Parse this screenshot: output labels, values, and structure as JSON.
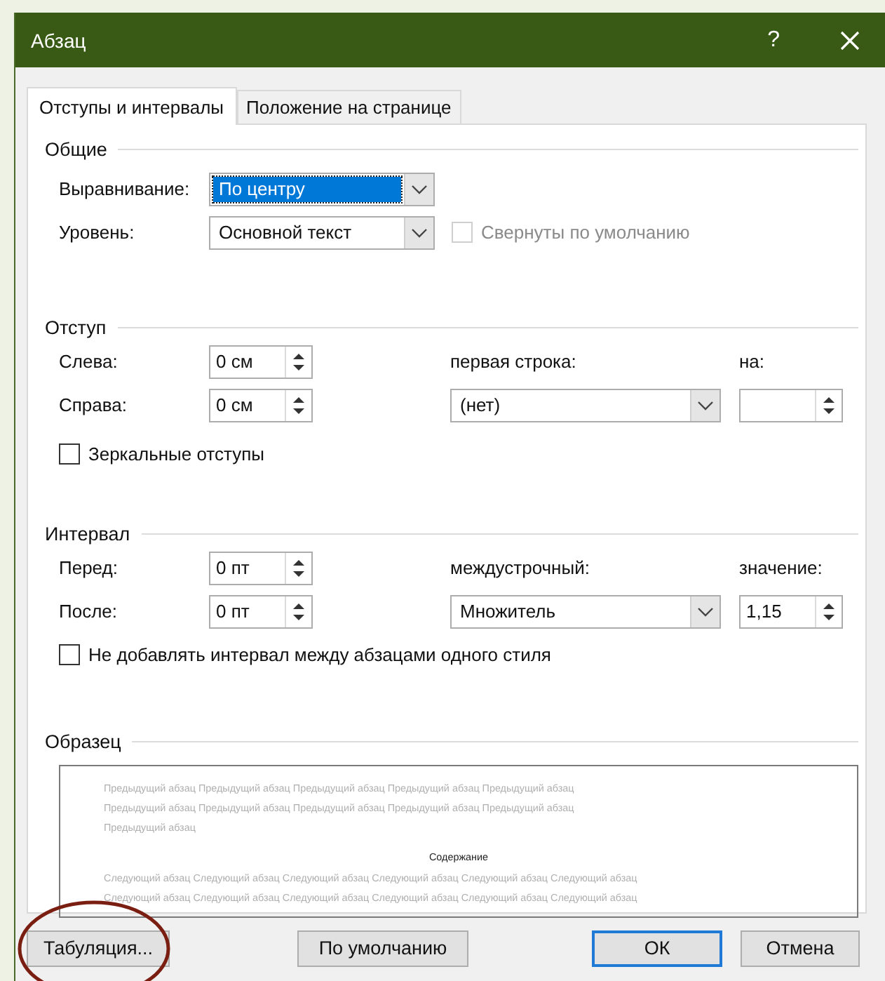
{
  "window": {
    "title": "Абзац",
    "help": "?"
  },
  "tabs": [
    {
      "label": "Отступы и интервалы",
      "selected": true
    },
    {
      "label": "Положение на странице",
      "selected": false
    }
  ],
  "general": {
    "title": "Общие",
    "alignment": {
      "label": "Выравнивание:",
      "value": "По центру",
      "focused": true
    },
    "level": {
      "label": "Уровень:",
      "value": "Основной текст"
    },
    "collapsed": {
      "label": "Свернуты по умолчанию",
      "checked": false,
      "disabled": true
    }
  },
  "indent": {
    "title": "Отступ",
    "left": {
      "label": "Слева:",
      "value": "0 см"
    },
    "right": {
      "label": "Справа:",
      "value": "0 см"
    },
    "first_line": {
      "label": "первая строка:",
      "value": "(нет)"
    },
    "by": {
      "label": "на:"
    },
    "mirror": {
      "label": "Зеркальные отступы",
      "checked": false
    }
  },
  "spacing": {
    "title": "Интервал",
    "before": {
      "label": "Перед:",
      "value": "0 пт"
    },
    "after": {
      "label": "После:",
      "value": "0 пт"
    },
    "line": {
      "label": "междустрочный:",
      "value": "Множитель"
    },
    "at": {
      "label": "значение:",
      "value": "1,15"
    },
    "no_space": {
      "label": "Не добавлять интервал между абзацами одного стиля",
      "checked": false
    }
  },
  "preview": {
    "title": "Образец",
    "previous": [
      "Предыдущий абзац Предыдущий абзац Предыдущий абзац Предыдущий абзац Предыдущий абзац",
      "Предыдущий абзац Предыдущий абзац Предыдущий абзац Предыдущий абзац Предыдущий абзац",
      "Предыдущий абзац"
    ],
    "content": "Содержание",
    "next": [
      "Следующий абзац Следующий абзац Следующий абзац Следующий абзац Следующий абзац Следующий абзац",
      "Следующий абзац Следующий абзац Следующий абзац Следующий абзац Следующий абзац Следующий абзац"
    ]
  },
  "buttons": [
    {
      "label": "Табуляция...",
      "default": false
    },
    {
      "label": "По умолчанию",
      "default": false
    },
    {
      "label": "ОК",
      "default": true
    },
    {
      "label": "Отмена",
      "default": false
    }
  ]
}
